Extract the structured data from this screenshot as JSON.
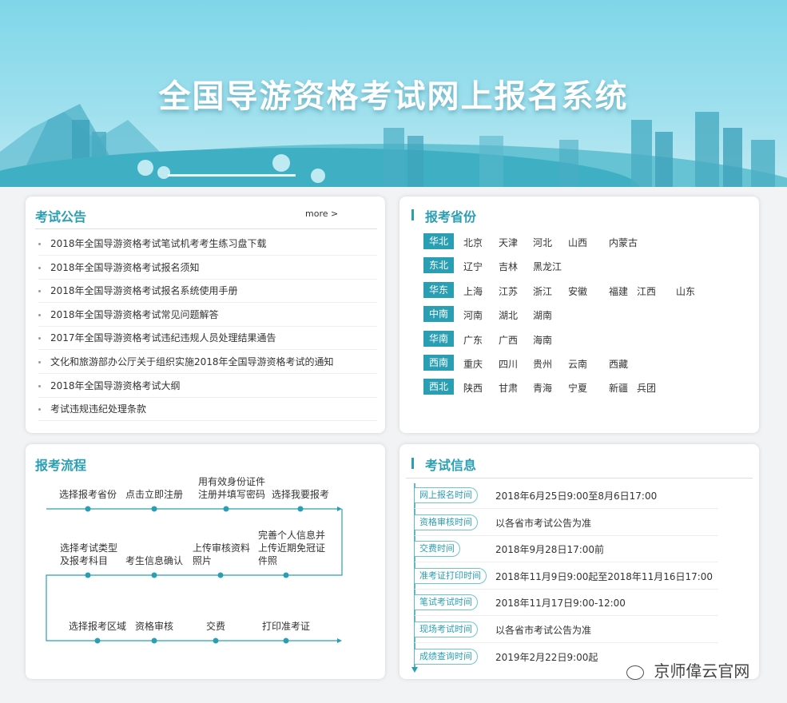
{
  "banner": {
    "title": "全国导游资格考试网上报名系统"
  },
  "notices": {
    "title": "考试公告",
    "more": "more >",
    "items": [
      "2018年全国导游资格考试笔试机考考生练习盘下载",
      "2018年全国导游资格考试报名须知",
      "2018年全国导游资格考试报名系统使用手册",
      "2018年全国导游资格考试常见问题解答",
      "2017年全国导游资格考试违纪违规人员处理结果通告",
      "文化和旅游部办公厅关于组织实施2018年全国导游资格考试的通知",
      "2018年全国导游资格考试大纲",
      "考试违规违纪处理条款"
    ]
  },
  "provinces": {
    "title": "报考省份",
    "regions": [
      {
        "name": "华北",
        "items": [
          "北京",
          "天津",
          "河北",
          "山西",
          "内蒙古"
        ]
      },
      {
        "name": "东北",
        "items": [
          "辽宁",
          "吉林",
          "黑龙江"
        ]
      },
      {
        "name": "华东",
        "items": [
          "上海",
          "江苏",
          "浙江",
          "安徽",
          "福建",
          "江西",
          "山东"
        ]
      },
      {
        "name": "中南",
        "items": [
          "河南",
          "湖北",
          "湖南"
        ]
      },
      {
        "name": "华南",
        "items": [
          "广东",
          "广西",
          "海南"
        ]
      },
      {
        "name": "西南",
        "items": [
          "重庆",
          "四川",
          "贵州",
          "云南",
          "西藏"
        ]
      },
      {
        "name": "西北",
        "items": [
          "陕西",
          "甘肃",
          "青海",
          "宁夏",
          "新疆",
          "兵团"
        ]
      }
    ]
  },
  "process": {
    "title": "报考流程",
    "steps": [
      "选择报考省份",
      "点击立即注册",
      "用有效身份证件\n注册并填写密码",
      "选择我要报考",
      "选择考试类型\n及报考科目",
      "考生信息确认",
      "上传审核资料\n照片",
      "完善个人信息并\n上传近期免冠证\n件照",
      "选择报考区域",
      "资格审核",
      "交费",
      "打印准考证"
    ]
  },
  "exam_info": {
    "title": "考试信息",
    "rows": [
      {
        "label": "网上报名时间",
        "value": "2018年6月25日9:00至8月6日17:00"
      },
      {
        "label": "资格审核时间",
        "value": "以各省市考试公告为准"
      },
      {
        "label": "交费时间",
        "value": "2018年9月28日17:00前"
      },
      {
        "label": "准考证打印时间",
        "value": "2018年11月9日9:00起至2018年11月16日17:00"
      },
      {
        "label": "笔试考试时间",
        "value": "2018年11月17日9:00-12:00"
      },
      {
        "label": "现场考试时间",
        "value": "以各省市考试公告为准"
      },
      {
        "label": "成绩查询时间",
        "value": "2019年2月22日9:00起"
      }
    ]
  },
  "watermark": {
    "text": "京师偉云官网",
    "icon": "wechat-icon"
  },
  "colors": {
    "accent": "#2a9fb3",
    "banner": "#8fdcec"
  }
}
